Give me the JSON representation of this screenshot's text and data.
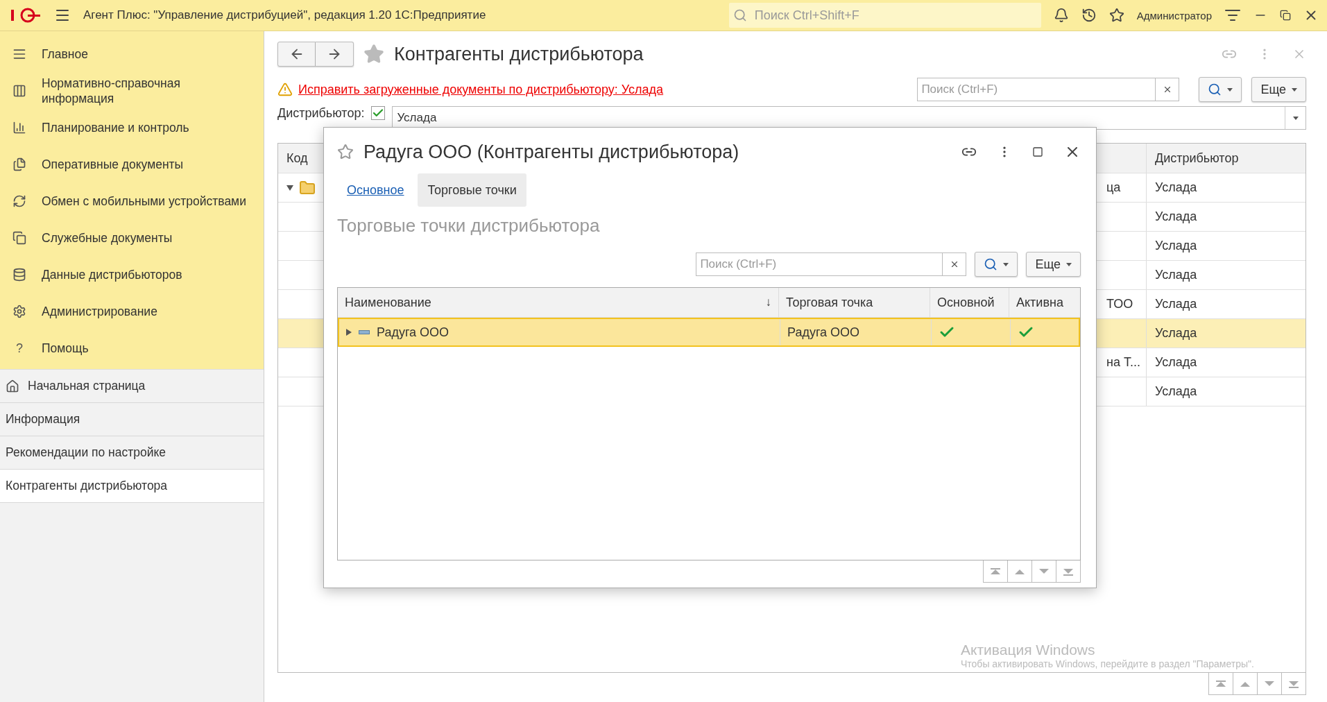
{
  "app": {
    "title": "Агент Плюс: \"Управление дистрибуцией\", редакция 1.20 1С:Предприятие",
    "search_placeholder": "Поиск Ctrl+Shift+F",
    "user": "Администратор"
  },
  "sidebar": {
    "sections": [
      {
        "label": "Главное"
      },
      {
        "label": "Нормативно-справочная информация"
      },
      {
        "label": "Планирование и контроль"
      },
      {
        "label": "Оперативные документы"
      },
      {
        "label": "Обмен с мобильными устройствами"
      },
      {
        "label": "Служебные документы"
      },
      {
        "label": "Данные дистрибьюторов"
      },
      {
        "label": "Администрирование"
      },
      {
        "label": "Помощь",
        "icon_char": "?"
      }
    ],
    "open_pages": [
      {
        "label": "Начальная страница",
        "selected": false
      },
      {
        "label": "Информация",
        "selected": false
      },
      {
        "label": "Рекомендации по настройке",
        "selected": false
      },
      {
        "label": "Контрагенты дистрибьютора",
        "selected": true
      }
    ]
  },
  "main": {
    "title": "Контрагенты дистрибьютора",
    "warning_link": "Исправить загруженные документы по дистрибьютору: Услада",
    "search_placeholder": "Поиск (Ctrl+F)",
    "more_button": "Еще",
    "filter": {
      "label": "Дистрибьютор:",
      "checked": true,
      "value": "Услада"
    },
    "table": {
      "columns": [
        "Код",
        "Дистрибьютор"
      ],
      "rows": [
        {
          "column_2": "ца",
          "distributor": "Услада",
          "selected": false,
          "expanded": true
        },
        {
          "distributor": "Услада",
          "selected": false
        },
        {
          "distributor": "Услада",
          "selected": false
        },
        {
          "distributor": "Услада",
          "selected": false
        },
        {
          "column_2": "ТОО",
          "distributor": "Услада",
          "selected": false
        },
        {
          "distributor": "Услада",
          "selected": true
        },
        {
          "column_2": "на Т...",
          "distributor": "Услада",
          "selected": false
        },
        {
          "distributor": "Услада",
          "selected": false
        }
      ]
    }
  },
  "dialog": {
    "title": "Радуга ООО (Контрагенты дистрибьютора)",
    "tabs": [
      {
        "label": "Основное",
        "selected": false
      },
      {
        "label": "Торговые точки",
        "selected": true
      }
    ],
    "section_title": "Торговые точки дистрибьютора",
    "search_placeholder": "Поиск (Ctrl+F)",
    "more_button": "Еще",
    "table": {
      "columns": [
        "Наименование",
        "Торговая точка",
        "Основной",
        "Активна"
      ],
      "sort_mark": "↓",
      "rows": [
        {
          "name": "Радуга ООО",
          "outlet": "Радуга ООО",
          "main": true,
          "active": true,
          "selected": true
        }
      ]
    }
  },
  "windows_activation": {
    "title": "Активация Windows",
    "subtitle": "Чтобы активировать Windows, перейдите в раздел \"Параметры\"."
  }
}
